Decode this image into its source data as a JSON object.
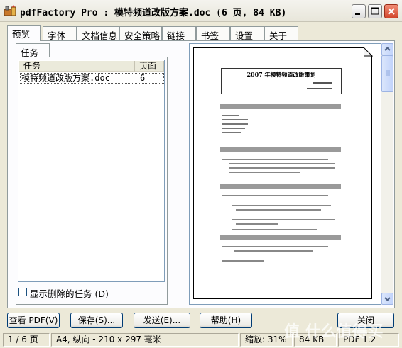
{
  "window": {
    "title": "pdfFactory Pro : 模特频道改版方案.doc (6 页, 84 KB)"
  },
  "tabs": [
    {
      "label": "预览"
    },
    {
      "label": "字体"
    },
    {
      "label": "文档信息"
    },
    {
      "label": "安全策略"
    },
    {
      "label": "链接"
    },
    {
      "label": "书签"
    },
    {
      "label": "设置"
    },
    {
      "label": "关于"
    }
  ],
  "task_panel": {
    "tab_label": "任务",
    "columns": [
      "任务",
      "页面"
    ],
    "rows": [
      {
        "task": "模特频道改版方案.doc",
        "pages": "6"
      }
    ],
    "show_deleted_label": "显示删除的任务 (D)"
  },
  "preview": {
    "doc_title": "2007 年模特频道改版策划"
  },
  "buttons": {
    "view_pdf": "查看 PDF(V)",
    "save": "保存(S)...",
    "send": "发送(E)...",
    "help": "帮助(H)",
    "close": "关闭"
  },
  "status": {
    "page": "1 / 6 页",
    "paper": "A4, 纵向 - 210 x 297 毫米",
    "zoom": "缩放: 31%",
    "size": "84 KB",
    "pdf_version": "PDF 1.2"
  },
  "watermark": "值 什么值得买"
}
